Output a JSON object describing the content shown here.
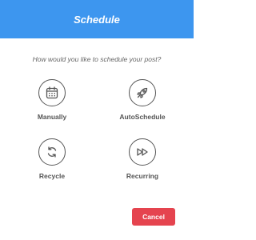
{
  "dialog": {
    "title": "Schedule",
    "prompt": "How would you like to schedule your post?"
  },
  "options": [
    {
      "label": "Manually",
      "icon": "calendar-icon"
    },
    {
      "label": "AutoSchedule",
      "icon": "rocket-icon"
    },
    {
      "label": "Recycle",
      "icon": "recycle-icon"
    },
    {
      "label": "Recurring",
      "icon": "fast-forward-icon"
    }
  ],
  "actions": {
    "cancel_label": "Cancel"
  },
  "colors": {
    "header_bg": "#3d96ef",
    "cancel_bg": "#e5444f",
    "icon_stroke": "#555555"
  }
}
